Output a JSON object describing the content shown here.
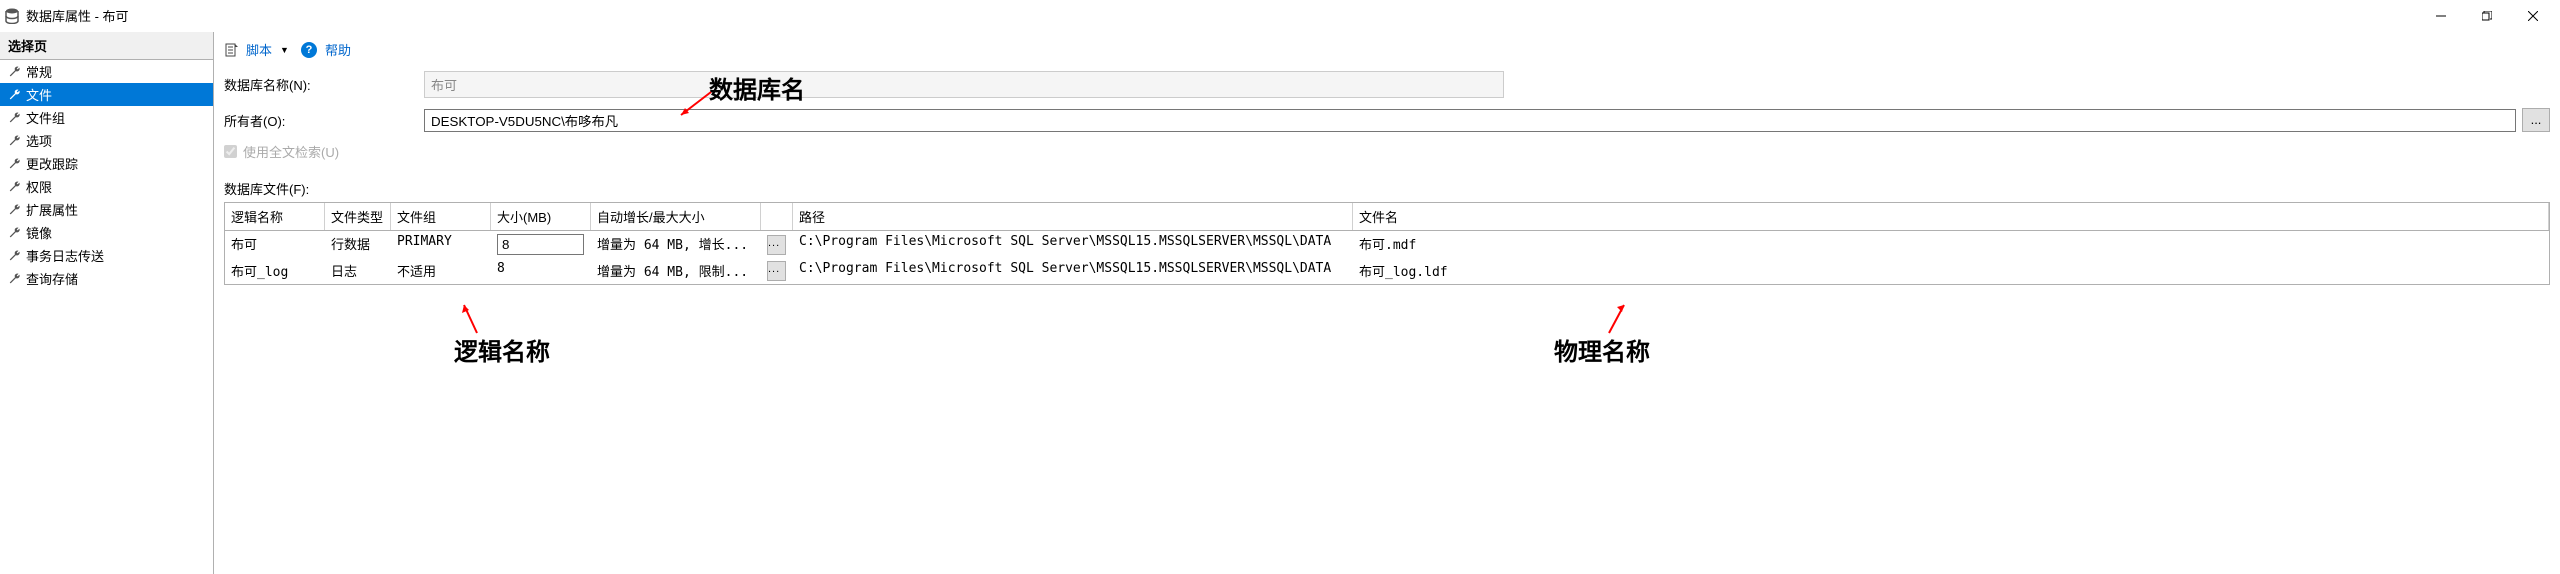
{
  "title": "数据库属性 - 布可",
  "sidebar": {
    "header": "选择页",
    "items": [
      "常规",
      "文件",
      "文件组",
      "选项",
      "更改跟踪",
      "权限",
      "扩展属性",
      "镜像",
      "事务日志传送",
      "查询存储"
    ],
    "selected_index": 1
  },
  "toolbar": {
    "script": "脚本",
    "help": "帮助"
  },
  "form": {
    "dbname_label": "数据库名称(N):",
    "dbname_value": "布可",
    "owner_label": "所有者(O):",
    "owner_value": "DESKTOP-V5DU5NC\\布哆布凡",
    "browse": "...",
    "fulltext_label": "使用全文检索(U)"
  },
  "files": {
    "section_label": "数据库文件(F):",
    "headers": {
      "logical": "逻辑名称",
      "type": "文件类型",
      "group": "文件组",
      "size": "大小(MB)",
      "autogrow": "自动增长/最大大小",
      "path": "路径",
      "filename": "文件名"
    },
    "rows": [
      {
        "logical": "布可",
        "type": "行数据",
        "group": "PRIMARY",
        "size": "8",
        "autogrow": "增量为 64 MB, 增长...",
        "path": "C:\\Program Files\\Microsoft SQL Server\\MSSQL15.MSSQLSERVER\\MSSQL\\DATA",
        "filename": "布可.mdf",
        "size_editable": true
      },
      {
        "logical": "布可_log",
        "type": "日志",
        "group": "不适用",
        "size": "8",
        "autogrow": "增量为 64 MB, 限制...",
        "path": "C:\\Program Files\\Microsoft SQL Server\\MSSQL15.MSSQLSERVER\\MSSQL\\DATA",
        "filename": "布可_log.ldf",
        "size_editable": false
      }
    ],
    "ellipsis": "..."
  },
  "annotations": {
    "dbname": "数据库名",
    "logical": "逻辑名称",
    "physical": "物理名称"
  }
}
